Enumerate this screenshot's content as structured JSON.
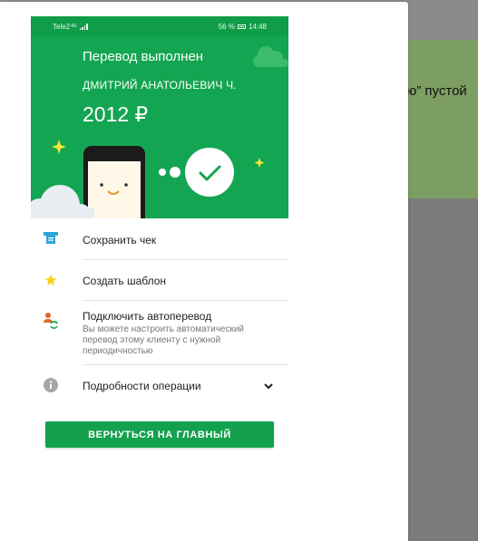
{
  "background": {
    "partial_text": "ю” пустой"
  },
  "status_bar": {
    "carrier": "Tele2",
    "network": "4G",
    "battery": "56 %",
    "time": "14:48"
  },
  "hero": {
    "title": "Перевод выполнен",
    "recipient": "ДМИТРИЙ АНАТОЛЬЕВИЧ Ч.",
    "amount": "2012 ₽"
  },
  "actions": [
    {
      "label": "Сохранить чек",
      "icon": "receipt-icon"
    },
    {
      "label": "Создать шаблон",
      "icon": "star-icon"
    },
    {
      "label": "Подключить автоперевод",
      "description": "Вы можете настроить автоматический перевод этому клиенту с нужной периодичностью",
      "icon": "autotransfer-icon"
    },
    {
      "label": "Подробности операции",
      "icon": "info-icon"
    }
  ],
  "cta_label": "ВЕРНУТЬСЯ НА ГЛАВНЫЙ",
  "colors": {
    "brand_green": "#14a552",
    "status_green": "#0f9d48",
    "button_green": "#13a14d",
    "star_yellow": "#f5d21b",
    "overlay_gray": "#7b7b7b"
  }
}
